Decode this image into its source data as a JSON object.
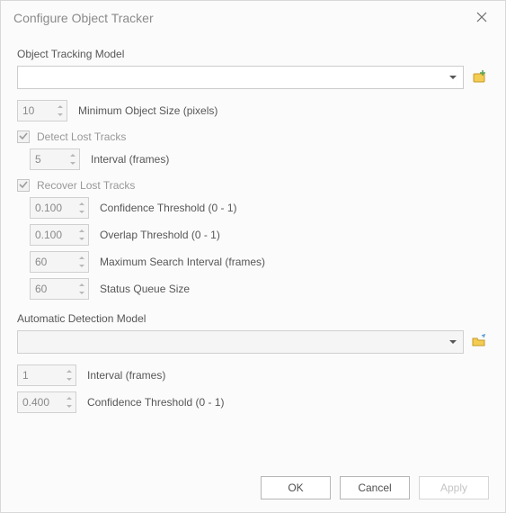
{
  "title": "Configure Object Tracker",
  "tracking_model_section": "Object Tracking Model",
  "min_size": {
    "value": "10",
    "label": "Minimum Object Size (pixels)"
  },
  "detect_lost": {
    "label": "Detect Lost Tracks"
  },
  "detect_interval": {
    "value": "5",
    "label": "Interval (frames)"
  },
  "recover_lost": {
    "label": "Recover Lost Tracks"
  },
  "conf_thresh": {
    "value": "0.100",
    "label": "Confidence Threshold (0 - 1)"
  },
  "overlap_thresh": {
    "value": "0.100",
    "label": "Overlap Threshold (0 - 1)"
  },
  "max_search": {
    "value": "60",
    "label": "Maximum Search Interval (frames)"
  },
  "queue_size": {
    "value": "60",
    "label": "Status Queue Size"
  },
  "auto_model_section": "Automatic Detection Model",
  "auto_interval": {
    "value": "1",
    "label": "Interval (frames)"
  },
  "auto_conf": {
    "value": "0.400",
    "label": "Confidence Threshold (0 - 1)"
  },
  "buttons": {
    "ok": "OK",
    "cancel": "Cancel",
    "apply": "Apply"
  }
}
